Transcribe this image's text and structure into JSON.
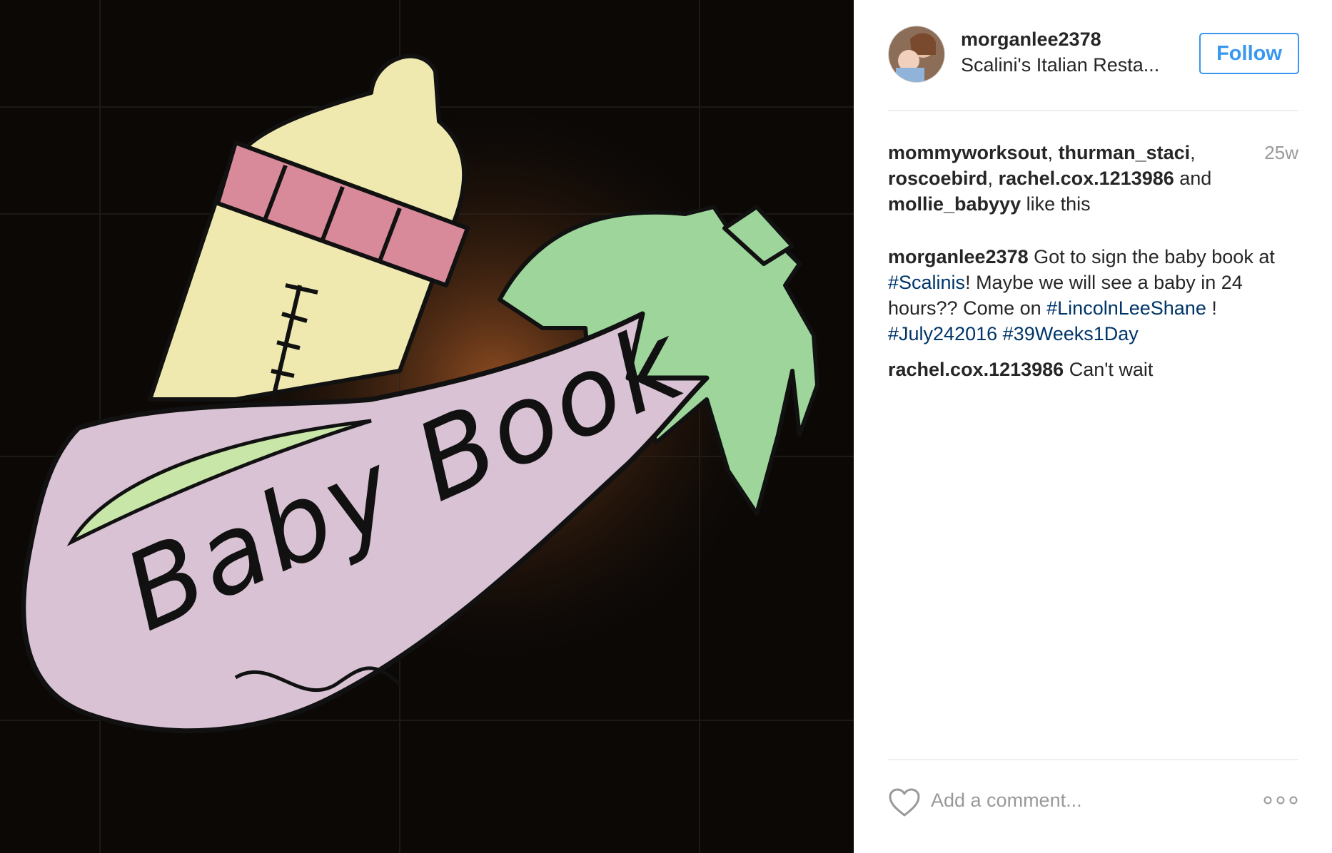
{
  "photo": {
    "sign_text": "Baby Book",
    "colors": {
      "bottle": "#efe9b0",
      "band": "#d98a9a",
      "eggplant": "#d8c2d4",
      "leaves": "#9ed59b",
      "background": "#0b0806"
    }
  },
  "post": {
    "username": "morganlee2378",
    "location": "Scalini's Italian Resta...",
    "follow_label": "Follow",
    "age": "25w",
    "likes": {
      "names_1": "mommyworksout",
      "names_2": "thurman_staci",
      "names_3": "roscoebird",
      "names_4": "rachel.cox.1213986",
      "names_5": "mollie_babyyy",
      "sep": ", ",
      "and": " and ",
      "suffix": " like this"
    },
    "caption": {
      "author": "morganlee2378",
      "text_1": " Got to sign the baby book at ",
      "tag_1": "#Scalinis",
      "text_2": "! Maybe we will see a baby in 24 hours?? Come on ",
      "tag_2": "#LincolnLeeShane",
      "text_3": " ! ",
      "tag_3": "#July242016",
      "tag_4": "#39Weeks1Day"
    },
    "comment": {
      "author": "rachel.cox.1213986",
      "text": " Can't wait"
    },
    "add_comment_placeholder": "Add a comment...",
    "icons": {
      "like": "heart-icon",
      "more": "more-options-icon",
      "avatar": "avatar"
    },
    "accent_color": "#3897f0",
    "hashtag_color": "#003569"
  }
}
